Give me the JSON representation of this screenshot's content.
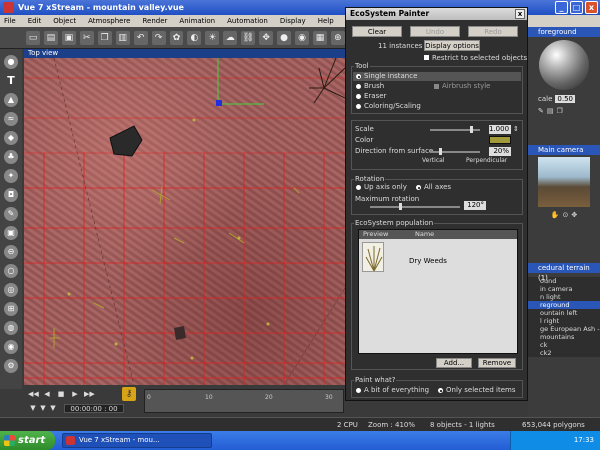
{
  "window": {
    "title": "Vue 7 xStream - mountain valley.vue",
    "min": "_",
    "max": "□",
    "close": "x"
  },
  "menu": [
    "File",
    "Edit",
    "Object",
    "Atmosphere",
    "Render",
    "Animation",
    "Automation",
    "Display",
    "Help"
  ],
  "viewport": {
    "title": "Top view"
  },
  "timeline": {
    "time": "00:00:00 : 00",
    "ticks": [
      "0",
      "10",
      "20",
      "30"
    ]
  },
  "ecosystem": {
    "title": "EcoSystem Painter",
    "close": "x",
    "buttons": {
      "clear": "Clear",
      "undo": "Undo",
      "redo": "Redo",
      "display_options": "Display options",
      "add": "Add...",
      "remove": "Remove"
    },
    "instances": "11 instances",
    "restrict_label": "Restrict to selected objects",
    "tool": {
      "title": "Tool",
      "options": [
        "Single instance",
        "Brush",
        "Eraser",
        "Coloring/Scaling"
      ],
      "selected": 0,
      "airbrush": "Airbrush style"
    },
    "scale": {
      "label": "Scale",
      "value": "1.000",
      "level": 0.82
    },
    "color": {
      "label": "Color",
      "swatch": "#a09a3a"
    },
    "direction": {
      "label": "Direction from surface",
      "value": "20%",
      "left": "Vertical",
      "right": "Perpendicular",
      "level": 0.2
    },
    "rotation": {
      "title": "Rotation",
      "options": [
        "Up axis only",
        "All axes"
      ],
      "selected": 1,
      "max_label": "Maximum rotation",
      "max_value": "120°",
      "level": 0.33
    },
    "population": {
      "title": "EcoSystem population",
      "columns": [
        "Preview",
        "Name"
      ],
      "items": [
        {
          "name": "Dry Weeds"
        }
      ]
    },
    "paint": {
      "title": "Paint what?",
      "options": [
        "A bit of everything",
        "Only selected items"
      ],
      "selected": 1
    }
  },
  "right_panel": {
    "material_head": "foreground",
    "scale_label": "cale",
    "scale_value": "0.50",
    "camera_head": "Main camera",
    "layers_head": "cedural terrain (1)",
    "layers": [
      "ound",
      "in camera",
      "n light",
      "reground",
      "ountain left",
      "l right",
      "ge European Ash - Aut",
      "mountains",
      "ck",
      "ck2"
    ],
    "selected_layer": 3
  },
  "status": {
    "cpu": "2 CPU",
    "zoom": "Zoom : 410%",
    "objects": "8 objects - 1 lights",
    "polygons": "653,044 polygons"
  },
  "taskbar": {
    "start": "start",
    "item": "Vue 7 xStream - mou...",
    "clock": "17:33"
  }
}
